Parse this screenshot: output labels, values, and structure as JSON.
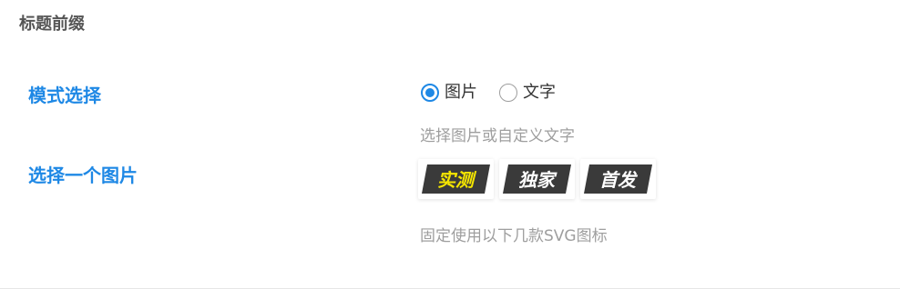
{
  "section": {
    "title": "标题前缀"
  },
  "mode": {
    "label": "模式选择",
    "options": [
      {
        "label": "图片",
        "checked": true
      },
      {
        "label": "文字",
        "checked": false
      }
    ],
    "hint": "选择图片或自定义文字"
  },
  "image": {
    "label": "选择一个图片",
    "options": [
      {
        "text": "实测",
        "text_color": "#f5e600",
        "bg": "#3a3a3a"
      },
      {
        "text": "独家",
        "text_color": "#ffffff",
        "bg": "#3a3a3a"
      },
      {
        "text": "首发",
        "text_color": "#ffffff",
        "bg": "#3a3a3a"
      }
    ],
    "hint": "固定使用以下几款SVG图标"
  },
  "colors": {
    "accent": "#1e88e5",
    "label_gray": "#555555",
    "hint_gray": "#9e9e9e"
  }
}
